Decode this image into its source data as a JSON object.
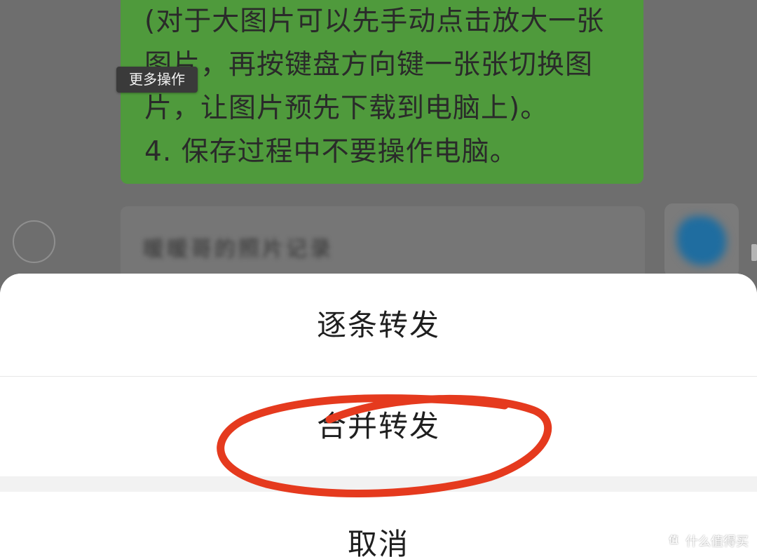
{
  "chat": {
    "green_message_lines": [
      "(对于大图片可以先手动点击放大一张",
      "图片，再按键盘方向键一张张切换图",
      "片，让图片预先下载到电脑上)。",
      "4. 保存过程中不要操作电脑。"
    ],
    "tooltip": "更多操作",
    "blurred_message": "暖暖哥的照片记录"
  },
  "action_sheet": {
    "forward_one_by_one": "逐条转发",
    "merge_forward": "合并转发",
    "cancel": "取消"
  },
  "annotation": {
    "highlighted_option": "合并转发",
    "color": "#e53a1e"
  },
  "watermark": {
    "text": "什么值得买",
    "logo_glyph": "值"
  },
  "colors": {
    "dim_background": "#6e6e6e",
    "green_bubble": "#4f9a3c",
    "sheet_background": "#ffffff"
  }
}
